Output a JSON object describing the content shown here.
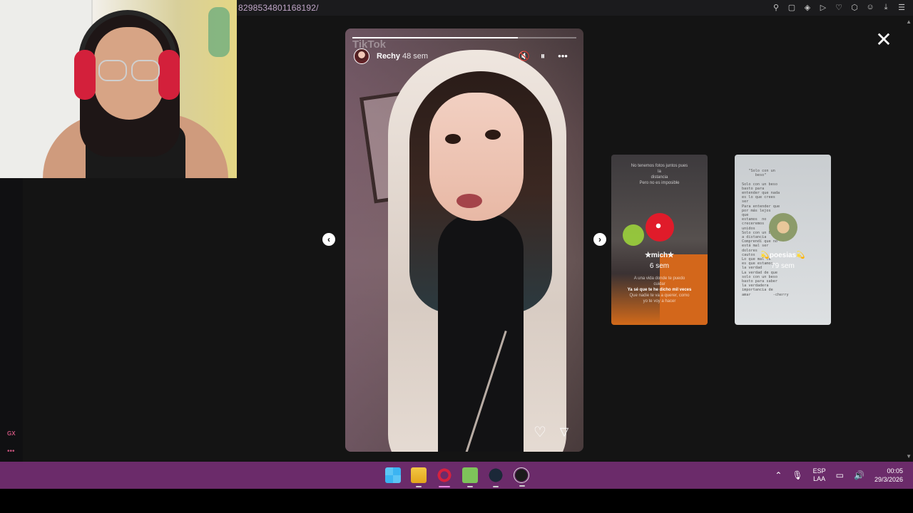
{
  "browser": {
    "url": "8298534801168192/",
    "toolbar_icons": [
      "pin-icon",
      "snapshot-icon",
      "shield-icon",
      "play-icon",
      "heart-icon",
      "extensions-icon",
      "account-icon",
      "download-icon",
      "menu-icon"
    ]
  },
  "sidebar": {
    "gx_label": "GX",
    "more_label": "•••"
  },
  "viewer": {
    "close_label": "✕",
    "prev_label": "‹",
    "next_label": "›"
  },
  "story": {
    "watermark": "TikTok",
    "username": "Rechy",
    "time": "48 sem",
    "progress": 0.74,
    "mute_icon": "🔇",
    "pause_icon": "⏸",
    "more_icon": "•••",
    "like_icon": "♡",
    "send_icon": "▽"
  },
  "side_stories": [
    {
      "name": "✮mich✮",
      "time": "6 sem",
      "top_text": [
        "No tenemos fotos juntos pues",
        "la",
        "distancia",
        "Pero no es imposible"
      ],
      "bottom_text": [
        "A una vida donde te puedo",
        "cuidar",
        "Ya sé que te he dicho mil veces",
        "Que nadie te va a querer, como",
        "yo te voy a hacer"
      ]
    },
    {
      "name": "💫poesias💫",
      "time": "79 sem",
      "poem": "   \"Solo con un\n      beso\"\n\nSolo con un beso\nbasto para\nentender que nada\nes lo que crees\nser\nPara entender que\npor más lejos\nque\nestamos  no\ncreceremos\nunidos\nSolo con un beso\na distancia\nComprendí que no\nestá mal ser\ndolores\ncautos\nLo que mal te\nes que estamos\nla verdad\nLa verdad de que\nsolo con un beso\nbasto para saber\nla verdadera\nimportancia de\namar          -cherry"
    }
  ],
  "taskbar": {
    "apps": [
      "windows-start-icon",
      "file-explorer-icon",
      "opera-gx-icon",
      "green-app-icon",
      "steam-icon",
      "obs-icon"
    ],
    "lang_1": "ESP",
    "lang_2": "LAA",
    "time": "00:05",
    "date": "29/3/2026"
  }
}
